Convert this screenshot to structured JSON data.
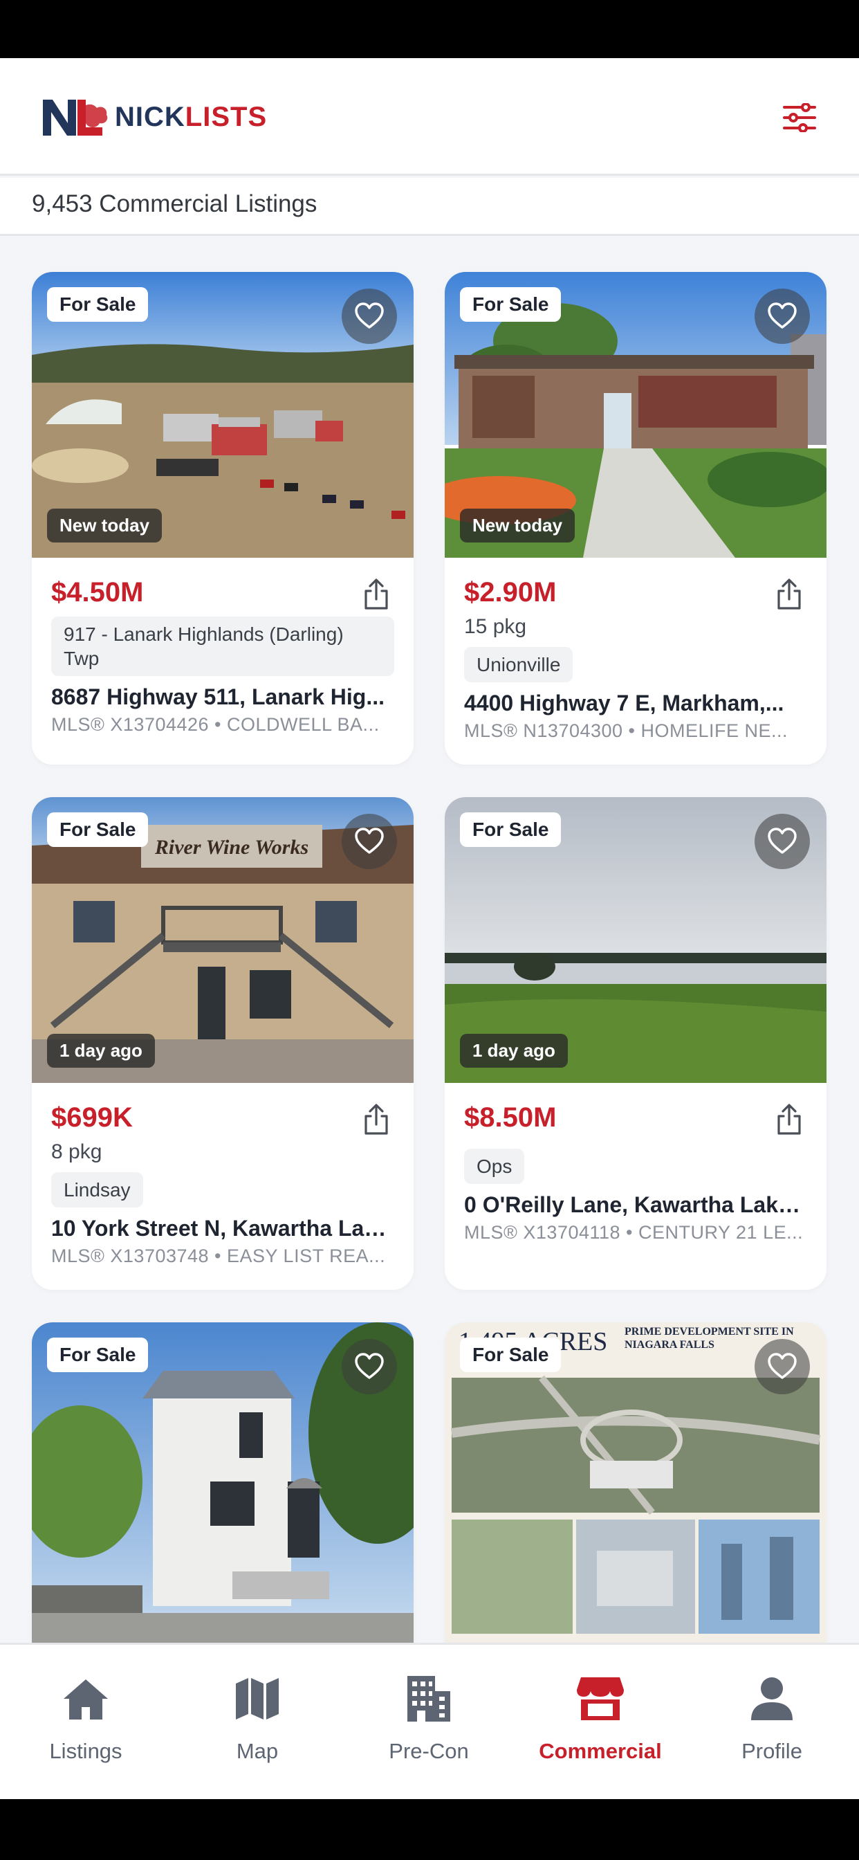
{
  "brand": {
    "name_part1": "NICK",
    "name_part2": "LISTS"
  },
  "listings_count_text": "9,453 Commercial Listings",
  "listings": [
    {
      "status": "For Sale",
      "age": "New today",
      "price": "$4.50M",
      "parking": "",
      "area": "917 - Lanark Highlands (Darling) Twp",
      "address": "8687 Highway 511, Lanark Hig...",
      "mls": "MLS® X13704426 • COLDWELL BA..."
    },
    {
      "status": "For Sale",
      "age": "New today",
      "price": "$2.90M",
      "parking": "15 pkg",
      "area": "Unionville",
      "address": "4400 Highway 7 E, Markham,...",
      "mls": "MLS® N13704300 • HOMELIFE NE..."
    },
    {
      "status": "For Sale",
      "age": "1 day ago",
      "sign_text": "River Wine Works",
      "price": "$699K",
      "parking": "8 pkg",
      "area": "Lindsay",
      "address": "10 York Street N, Kawartha Lak...",
      "mls": "MLS® X13703748 • EASY LIST REA..."
    },
    {
      "status": "For Sale",
      "age": "1 day ago",
      "price": "$8.50M",
      "parking": "",
      "area": "Ops",
      "address": "0 O'Reilly Lane, Kawartha Lake...",
      "mls": "MLS® X13704118 • CENTURY 21 LE..."
    },
    {
      "status": "For Sale"
    },
    {
      "status": "For Sale",
      "flyer_title": "1,495 ACRES",
      "flyer_subtitle": "PRIME DEVELOPMENT SITE IN NIAGARA FALLS"
    }
  ],
  "tabs": [
    {
      "label": "Listings",
      "icon": "home-icon",
      "active": false
    },
    {
      "label": "Map",
      "icon": "map-icon",
      "active": false
    },
    {
      "label": "Pre-Con",
      "icon": "building-icon",
      "active": false
    },
    {
      "label": "Commercial",
      "icon": "store-icon",
      "active": true
    },
    {
      "label": "Profile",
      "icon": "user-icon",
      "active": false
    }
  ],
  "colors": {
    "accent": "#c8202a",
    "navy": "#22355b",
    "tab_inactive": "#5d6573"
  }
}
